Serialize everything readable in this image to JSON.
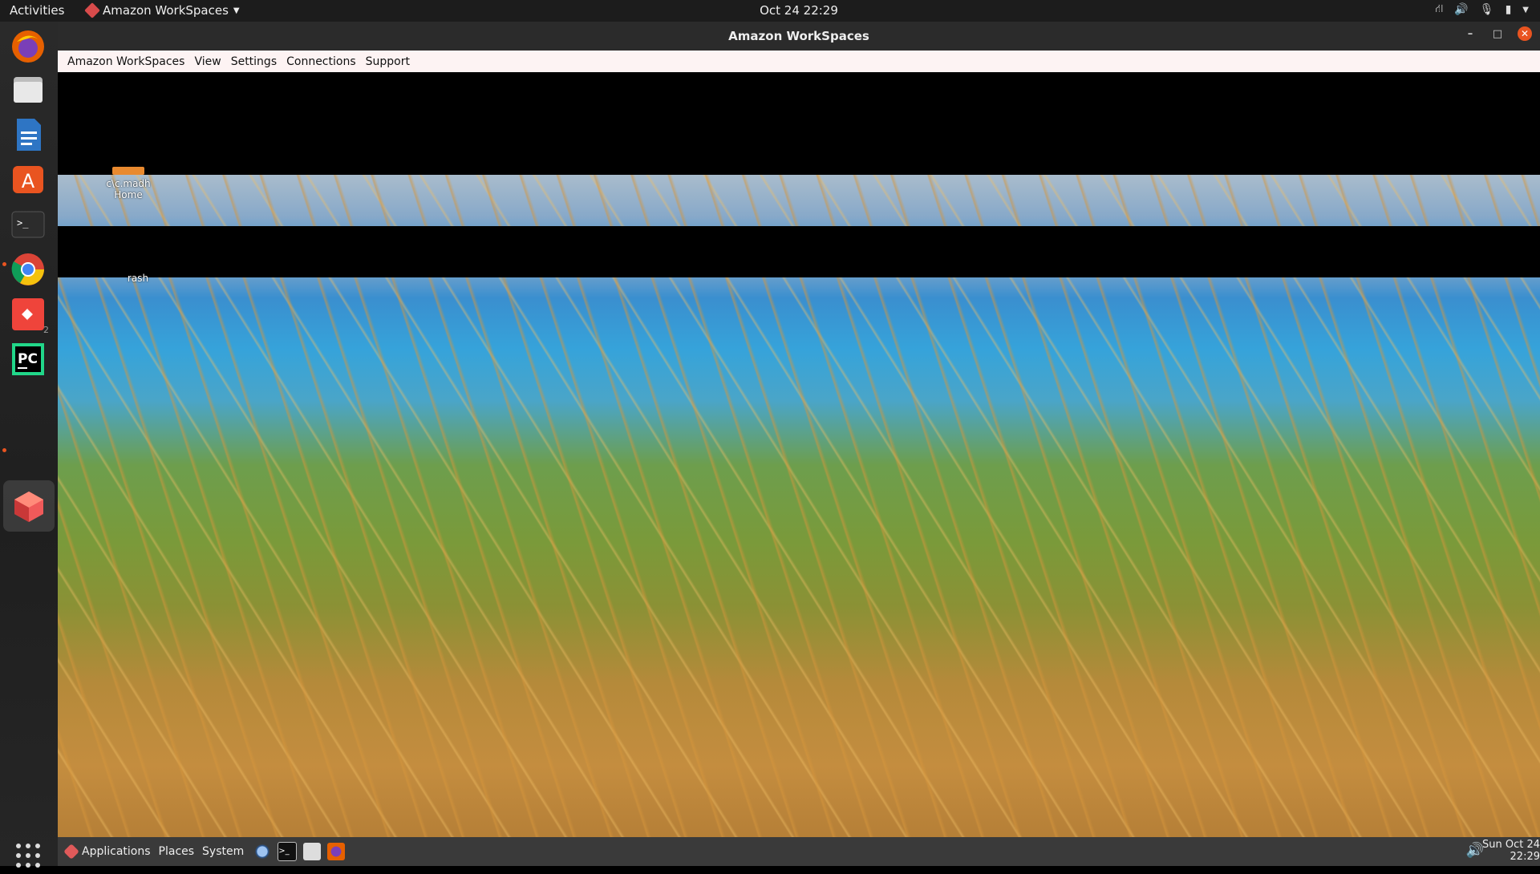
{
  "topbar": {
    "activities": "Activities",
    "app_name": "Amazon WorkSpaces",
    "clock": "Oct 24  22:29"
  },
  "window": {
    "title": "Amazon WorkSpaces",
    "menu": [
      "Amazon WorkSpaces",
      "View",
      "Settings",
      "Connections",
      "Support"
    ]
  },
  "desktop_icons": {
    "home_label_1": "c\\c.madh",
    "home_label_2": "Home",
    "trash_label": "rash"
  },
  "remote_taskbar": {
    "applications": "Applications",
    "places": "Places",
    "system": "System",
    "clock_line1": "Sun Oct 24",
    "clock_line2": "22:29"
  },
  "dock_badge": "2"
}
